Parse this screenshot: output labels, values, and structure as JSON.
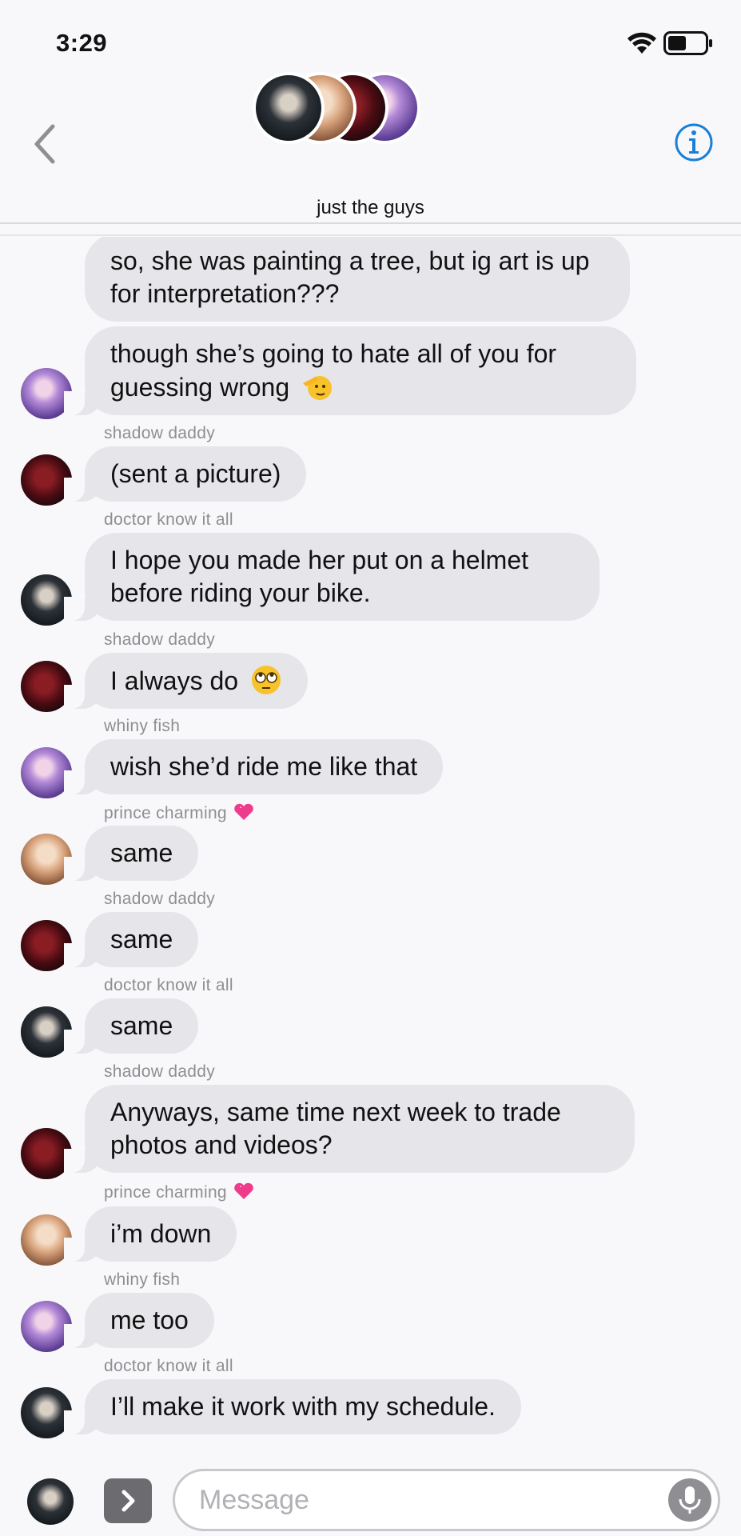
{
  "status_bar": {
    "time": "3:29"
  },
  "header": {
    "group_name": "just the guys"
  },
  "messages": [
    {
      "text": "so, she was painting a tree, but ig art is up for interpretation???"
    },
    {
      "text": "though she’s going to hate all of you for guessing wrong"
    },
    {
      "sender": "shadow daddy",
      "text": "(sent a picture)"
    },
    {
      "sender": "doctor know it all",
      "text": "I hope you made her put on a helmet before riding your bike."
    },
    {
      "sender": "shadow daddy",
      "text": "I always do"
    },
    {
      "sender": "whiny fish",
      "text": "wish she’d ride me like that"
    },
    {
      "sender": "prince charming",
      "text": "same"
    },
    {
      "sender": "shadow daddy",
      "text": "same"
    },
    {
      "sender": "doctor know it all",
      "text": "same"
    },
    {
      "sender": "shadow daddy",
      "text": "Anyways, same time next week to trade photos and videos?"
    },
    {
      "sender": "prince charming",
      "text": "i’m down"
    },
    {
      "sender": "whiny fish",
      "text": "me too"
    },
    {
      "sender": "doctor know it all",
      "text": "I’ll make it work with my schedule."
    }
  ],
  "composer": {
    "placeholder": "Message"
  },
  "icons": {
    "back": "chevron-left-icon",
    "info": "info-icon",
    "apps": "chevron-right-icon",
    "mic": "microphone-icon",
    "wifi": "wifi-icon",
    "battery": "battery-icon"
  },
  "colors": {
    "bubble": "#e5e5ea",
    "accent": "#1a7fd9",
    "sender_label": "#8e8e93"
  }
}
